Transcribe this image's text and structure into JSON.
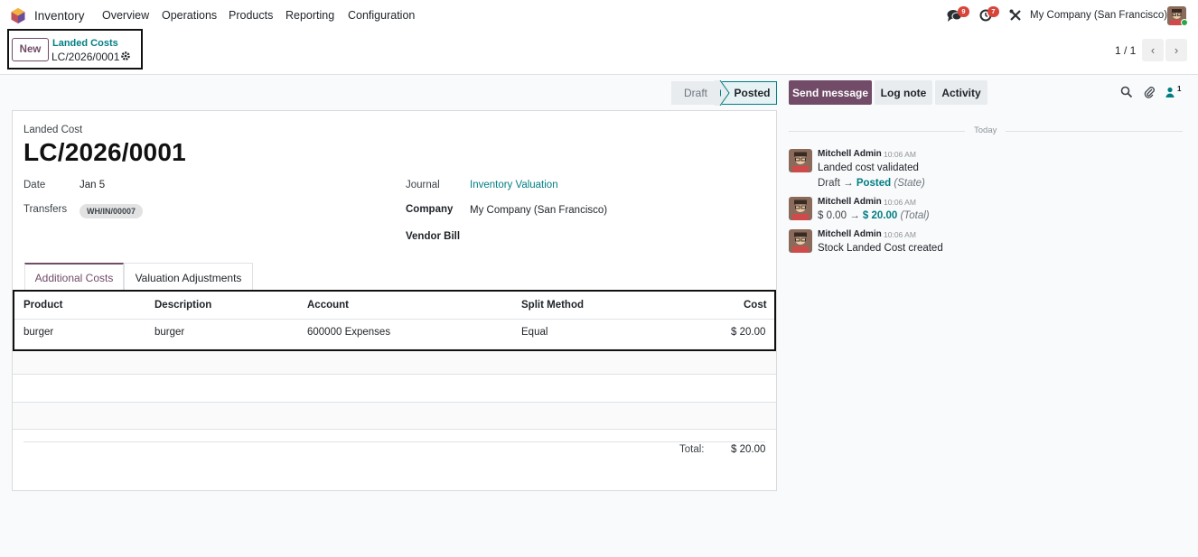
{
  "navbar": {
    "app_name": "Inventory",
    "menu": [
      "Overview",
      "Operations",
      "Products",
      "Reporting",
      "Configuration"
    ],
    "messages_count": "9",
    "activities_count": "7",
    "company": "My Company (San Francisco)"
  },
  "control_panel": {
    "new_label": "New",
    "breadcrumb_parent": "Landed Costs",
    "breadcrumb_current": "LC/2026/0001",
    "pager_value": "1 / 1"
  },
  "statusbar": {
    "stages": [
      "Draft",
      "Posted"
    ],
    "current": "Posted"
  },
  "form": {
    "model_label": "Landed Cost",
    "name": "LC/2026/0001",
    "date_label": "Date",
    "date_value": "Jan 5",
    "transfers_label": "Transfers",
    "transfers_tag": "WH/IN/00007",
    "journal_label": "Journal",
    "journal_value": "Inventory Valuation",
    "company_label": "Company",
    "company_value": "My Company (San Francisco)",
    "vendor_bill_label": "Vendor Bill",
    "vendor_bill_value": "",
    "tabs": [
      "Additional Costs",
      "Valuation Adjustments"
    ],
    "table": {
      "headers": [
        "Product",
        "Description",
        "Account",
        "Split Method",
        "Cost"
      ],
      "rows": [
        [
          "burger",
          "burger",
          "600000 Expenses",
          "Equal",
          "$ 20.00"
        ]
      ]
    },
    "total_label": "Total:",
    "total_value": "$ 20.00"
  },
  "chatter": {
    "send_message": "Send message",
    "log_note": "Log note",
    "activity": "Activity",
    "followers_count": "1",
    "date_separator": "Today",
    "messages": [
      {
        "author": "Mitchell Admin",
        "time": "10:06 AM",
        "body": "Landed cost validated",
        "tracking": {
          "old": "Draft",
          "arrow": "→",
          "new": "Posted",
          "field": "(State)"
        }
      },
      {
        "author": "Mitchell Admin",
        "time": "10:06 AM",
        "body": "",
        "tracking": {
          "old": "$ 0.00",
          "arrow": "→",
          "new": "$ 20.00",
          "field": "(Total)"
        }
      },
      {
        "author": "Mitchell Admin",
        "time": "10:06 AM",
        "body": "Stock Landed Cost created"
      }
    ]
  },
  "colors": {
    "brand": "#714B67",
    "link": "#017e84",
    "badge": "#d9443a"
  }
}
